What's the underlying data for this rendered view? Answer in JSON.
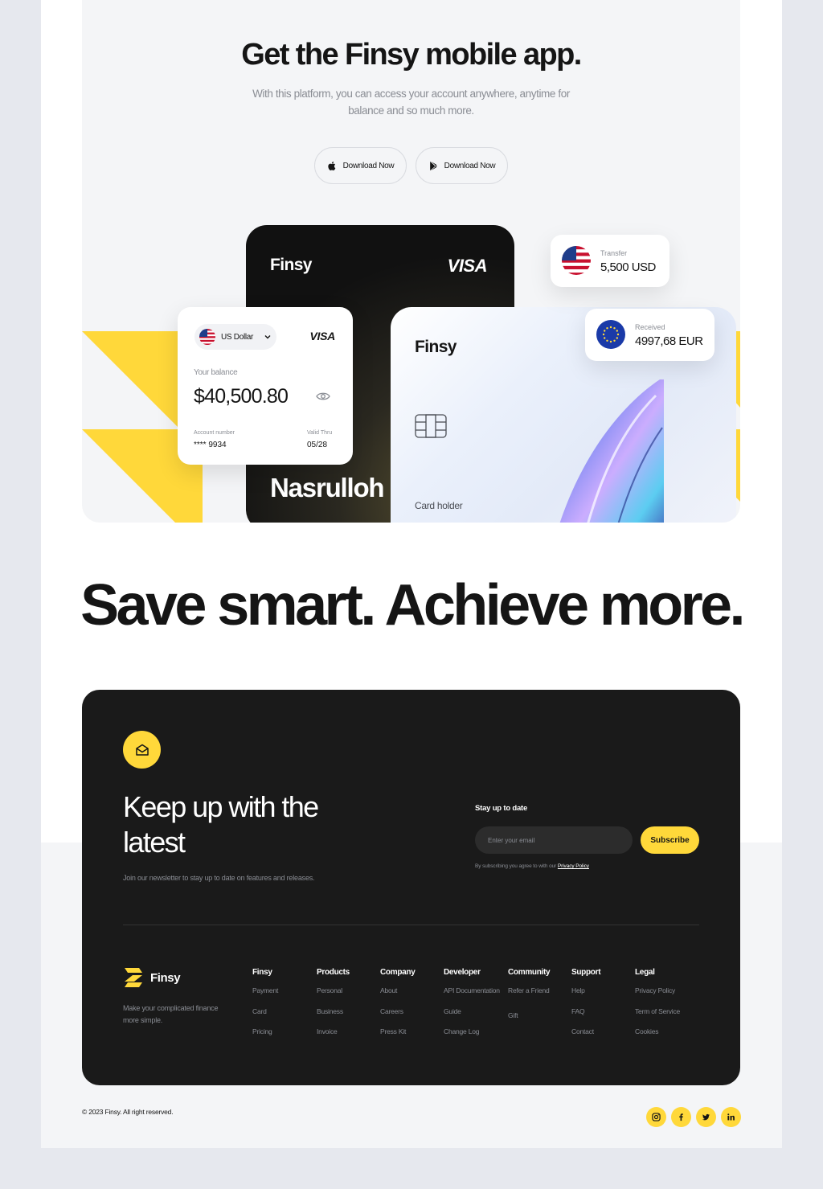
{
  "hero": {
    "title": "Get the Finsy mobile app.",
    "subtitle": "With this platform, you can access your account anywhere, anytime for balance and so much more.",
    "buttons": [
      {
        "label": "Download Now",
        "icon": "apple-icon"
      },
      {
        "label": "Download Now",
        "icon": "play-store-icon"
      }
    ]
  },
  "cards": {
    "black": {
      "brand": "Finsy",
      "network": "VISA",
      "holder_name": "Nasrulloh"
    },
    "balance": {
      "currency": "US Dollar",
      "network": "VISA",
      "balance_label": "Your balance",
      "balance": "$40,500.80",
      "account_label": "Account number",
      "account": "**** 9934",
      "valid_label": "Valid Thru",
      "valid": "05/28"
    },
    "light": {
      "brand": "Finsy",
      "holder_label": "Card holder"
    },
    "transfer": {
      "label": "Transfer",
      "value": "5,500 USD"
    },
    "received": {
      "label": "Received",
      "value": "4997,68 EUR"
    }
  },
  "slogan": "Save smart.  Achieve more.",
  "newsletter": {
    "title": "Keep up with the latest",
    "subtitle": "Join our newsletter to stay up to date on features and releases.",
    "stay_label": "Stay up to date",
    "email_placeholder": "Enter your email",
    "subscribe_label": "Subscribe",
    "agree_text": "By subscribing you agree to with our",
    "privacy_link": "Privacy Policy"
  },
  "footer": {
    "brand": "Finsy",
    "tagline": "Make your complicated finance more simple.",
    "columns": [
      {
        "heading": "Finsy",
        "links": [
          "Payment",
          "Card",
          "Pricing"
        ]
      },
      {
        "heading": "Products",
        "links": [
          "Personal",
          "Business",
          "Invoice"
        ]
      },
      {
        "heading": "Company",
        "links": [
          "About",
          "Careers",
          "Press Kit"
        ]
      },
      {
        "heading": "Developer",
        "links": [
          "API Documentation",
          "Guide",
          "Change Log"
        ]
      },
      {
        "heading": "Community",
        "links": [
          "Refer a Friend",
          "Gift"
        ]
      },
      {
        "heading": "Support",
        "links": [
          "Help",
          "FAQ",
          "Contact"
        ]
      },
      {
        "heading": "Legal",
        "links": [
          "Privacy Policy",
          "Term of Service",
          "Cookies"
        ]
      }
    ],
    "copyright": "© 2023 Finsy. All right reserved.",
    "social": [
      "instagram-icon",
      "facebook-icon",
      "twitter-icon",
      "linkedin-icon"
    ]
  },
  "colors": {
    "accent": "#ffd83a",
    "dark": "#1a1a1a",
    "light_bg": "#f4f5f7"
  }
}
